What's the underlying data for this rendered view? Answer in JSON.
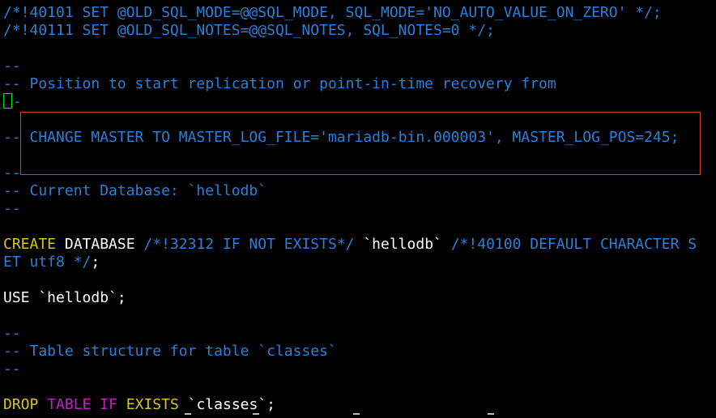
{
  "editor": {
    "lines": [
      {
        "segments": [
          {
            "text": "/*!40101 SET @OLD_SQL_MODE=@@SQL_MODE, SQL_MODE='NO_AUTO_VALUE_ON_ZERO' */;",
            "color": "blue"
          }
        ]
      },
      {
        "segments": [
          {
            "text": "/*!40111 SET @OLD_SQL_NOTES=@@SQL_NOTES, SQL_NOTES=0 */;",
            "color": "blue"
          }
        ]
      },
      {
        "segments": []
      },
      {
        "segments": [
          {
            "text": "--",
            "color": "blue"
          }
        ]
      },
      {
        "segments": [
          {
            "text": "-- Position to start replication or point-in-time recovery from",
            "color": "blue"
          }
        ]
      },
      {
        "segments": [
          {
            "text": "-",
            "color": "blue"
          }
        ],
        "cursor": true
      },
      {
        "segments": []
      },
      {
        "segments": [
          {
            "text": "-- CHANGE MASTER TO MASTER_LOG_FILE='mariadb-bin.000003', MASTER_LOG_POS=245;",
            "color": "blue"
          }
        ]
      },
      {
        "segments": []
      },
      {
        "segments": [
          {
            "text": "--",
            "color": "blue"
          }
        ]
      },
      {
        "segments": [
          {
            "text": "-- Current Database: `hellodb`",
            "color": "blue"
          }
        ]
      },
      {
        "segments": [
          {
            "text": "--",
            "color": "blue"
          }
        ]
      },
      {
        "segments": []
      },
      {
        "segments": [
          {
            "text": "CREATE",
            "color": "yellow"
          },
          {
            "text": " DATABASE ",
            "color": "white"
          },
          {
            "text": "/*!32312 IF NOT EXISTS*/",
            "color": "blue"
          },
          {
            "text": " `hellodb` ",
            "color": "white"
          },
          {
            "text": "/*!40100 DEFAULT CHARACTER S",
            "color": "blue"
          }
        ]
      },
      {
        "segments": [
          {
            "text": "ET utf8 */",
            "color": "blue"
          },
          {
            "text": ";",
            "color": "white"
          }
        ]
      },
      {
        "segments": []
      },
      {
        "segments": [
          {
            "text": "USE `hellodb`;",
            "color": "white"
          }
        ]
      },
      {
        "segments": []
      },
      {
        "segments": [
          {
            "text": "--",
            "color": "blue"
          }
        ]
      },
      {
        "segments": [
          {
            "text": "-- Table structure for table `classes`",
            "color": "blue"
          }
        ]
      },
      {
        "segments": [
          {
            "text": "--",
            "color": "blue"
          }
        ]
      },
      {
        "segments": []
      },
      {
        "segments": [
          {
            "text": "DROP",
            "color": "yellow"
          },
          {
            "text": " ",
            "color": "white"
          },
          {
            "text": "TABLE",
            "color": "magenta"
          },
          {
            "text": " ",
            "color": "white"
          },
          {
            "text": "IF",
            "color": "magenta"
          },
          {
            "text": " ",
            "color": "white"
          },
          {
            "text": "EXISTS",
            "color": "yellow"
          },
          {
            "text": " `classes`;",
            "color": "white"
          }
        ]
      }
    ]
  },
  "colors": {
    "background": "#000000",
    "blue": "#2b7fd8",
    "yellow": "#d6c321",
    "magenta": "#c21fc2",
    "white": "#ffffff",
    "cursor": "#00e000",
    "highlight_box": "#e03a2f"
  }
}
